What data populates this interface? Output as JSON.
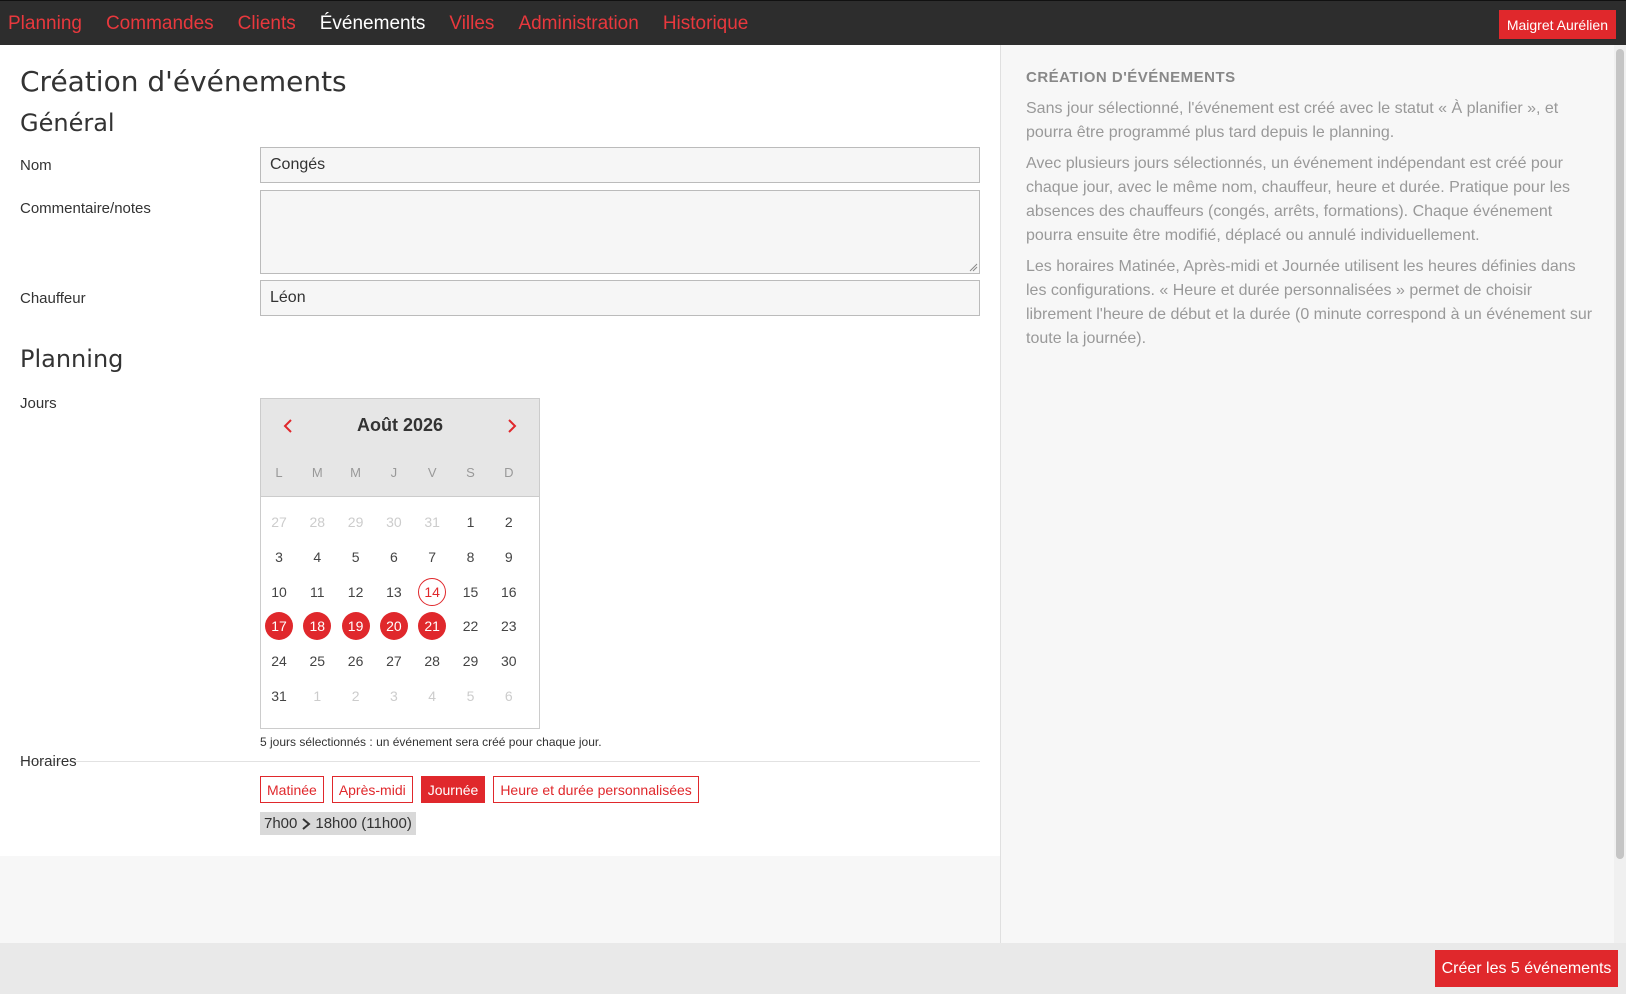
{
  "nav": {
    "items": [
      "Planning",
      "Commandes",
      "Clients",
      "Événements",
      "Villes",
      "Administration",
      "Historique"
    ],
    "active": "Événements",
    "user": "Maigret Aurélien"
  },
  "main": {
    "title": "Création d'événements",
    "general_title": "Général",
    "nom_label": "Nom",
    "nom_value": "Congés",
    "commentaire_label": "Commentaire/notes",
    "commentaire_value": "",
    "chauffeur_label": "Chauffeur",
    "chauffeur_value": "Léon",
    "planning_title": "Planning",
    "jours_label": "Jours",
    "calendar": {
      "month": "Août 2026",
      "weekdays": [
        "L",
        "M",
        "M",
        "J",
        "V",
        "S",
        "D"
      ],
      "weeks": [
        [
          "27",
          "28",
          "29",
          "30",
          "31",
          "1",
          "2"
        ],
        [
          "3",
          "4",
          "5",
          "6",
          "7",
          "8",
          "9"
        ],
        [
          "10",
          "11",
          "12",
          "13",
          "14",
          "15",
          "16"
        ],
        [
          "17",
          "18",
          "19",
          "20",
          "21",
          "22",
          "23"
        ],
        [
          "24",
          "25",
          "26",
          "27",
          "28",
          "29",
          "30"
        ],
        [
          "31",
          "1",
          "2",
          "3",
          "4",
          "5",
          "6"
        ]
      ],
      "today": "14",
      "selected": [
        "17",
        "18",
        "19",
        "20",
        "21"
      ]
    },
    "calendar_hint": "5 jours sélectionnés : un événement sera créé pour chaque jour.",
    "horaires_label": "Horaires",
    "horaires_options": [
      "Matinée",
      "Après-midi",
      "Journée",
      "Heure et durée personnalisées"
    ],
    "horaires_active": "Journée",
    "time_start": "7h00",
    "time_end": "18h00 (11h00)"
  },
  "side": {
    "title": "CRÉATION D'ÉVÉNEMENTS",
    "paragraphs": [
      "Sans jour sélectionné, l'événement est créé avec le statut « À planifier », et pourra être programmé plus tard depuis le planning.",
      "Avec plusieurs jours sélectionnés, un événement indépendant est créé pour chaque jour, avec le même nom, chauffeur, heure et durée. Pratique pour les absences des chauffeurs (congés, arrêts, formations). Chaque événement pourra ensuite être modifié, déplacé ou annulé individuellement.",
      "Les horaires Matinée, Après-midi et Journée utilisent les heures définies dans les configurations. « Heure et durée personnalisées » permet de choisir librement l'heure de début et la durée (0 minute correspond à un événement sur toute la journée)."
    ]
  },
  "footer": {
    "create_label": "Créer les 5 événements"
  },
  "colors": {
    "accent": "#e0282c",
    "nav_bg": "#2d2d2d"
  }
}
